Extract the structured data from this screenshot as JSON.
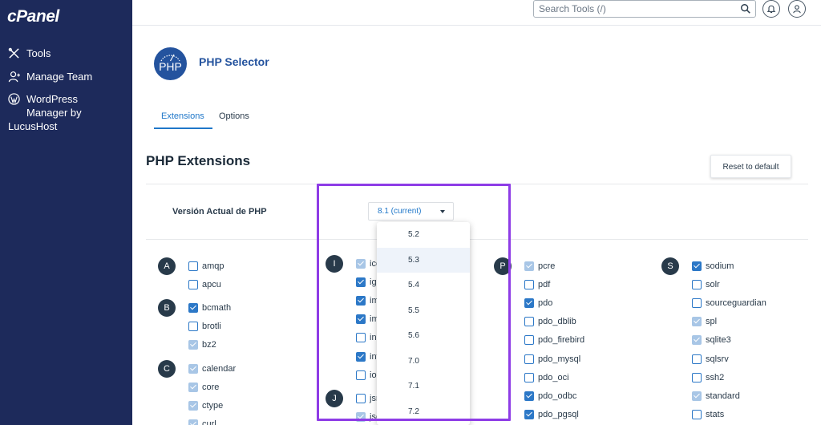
{
  "sidebar": {
    "logo": "cPanel",
    "items": [
      {
        "label": "Tools",
        "icon": "tools-icon"
      },
      {
        "label": "Manage Team",
        "icon": "manage-team-icon"
      },
      {
        "lines": [
          "WordPress",
          "Manager by",
          "LucusHost"
        ],
        "icon": "wordpress-icon"
      }
    ]
  },
  "topbar": {
    "search_placeholder": "Search Tools (/)",
    "icons": [
      "search-icon",
      "bell-icon",
      "user-icon"
    ]
  },
  "page": {
    "logo_text": "PHP",
    "title": "PHP Selector",
    "tabs": [
      {
        "label": "Extensions",
        "active": true
      },
      {
        "label": "Options",
        "active": false
      }
    ],
    "section_title": "PHP Extensions",
    "reset_button": "Reset to default",
    "version_label": "Versión Actual de PHP",
    "version_selected": "8.1 (current)"
  },
  "dropdown_options": [
    "5.2",
    "5.3",
    "5.4",
    "5.5",
    "5.6",
    "7.0",
    "7.1",
    "7.2"
  ],
  "dropdown_highlighted": "5.3",
  "columns": [
    {
      "groups": [
        {
          "letter": "A",
          "items": [
            {
              "name": "amqp",
              "state": "off"
            },
            {
              "name": "apcu",
              "state": "off"
            }
          ]
        },
        {
          "letter": "B",
          "items": [
            {
              "name": "bcmath",
              "state": "on"
            },
            {
              "name": "brotli",
              "state": "off"
            },
            {
              "name": "bz2",
              "state": "disabled"
            }
          ]
        },
        {
          "letter": "C",
          "items": [
            {
              "name": "calendar",
              "state": "disabled"
            },
            {
              "name": "core",
              "state": "disabled"
            },
            {
              "name": "ctype",
              "state": "disabled"
            },
            {
              "name": "curl",
              "state": "disabled"
            }
          ]
        }
      ]
    },
    {
      "groups": [
        {
          "letter": "I",
          "items": [
            {
              "name": "icc",
              "state": "disabled"
            },
            {
              "name": "igb",
              "state": "on"
            },
            {
              "name": "im",
              "state": "on"
            },
            {
              "name": "im",
              "state": "on"
            },
            {
              "name": "inc",
              "state": "off"
            },
            {
              "name": "int",
              "state": "on"
            },
            {
              "name": "ion",
              "state": "off"
            }
          ]
        },
        {
          "letter": "J",
          "items": [
            {
              "name": "jsn",
              "state": "off"
            },
            {
              "name": "jso",
              "state": "disabled"
            }
          ]
        }
      ]
    },
    {
      "groups": [
        {
          "letter": "P",
          "items": [
            {
              "name": "pcre",
              "state": "disabled"
            },
            {
              "name": "pdf",
              "state": "off"
            },
            {
              "name": "pdo",
              "state": "on"
            },
            {
              "name": "pdo_dblib",
              "state": "off"
            },
            {
              "name": "pdo_firebird",
              "state": "off"
            },
            {
              "name": "pdo_mysql",
              "state": "off"
            },
            {
              "name": "pdo_oci",
              "state": "off"
            },
            {
              "name": "pdo_odbc",
              "state": "on"
            },
            {
              "name": "pdo_pgsql",
              "state": "on"
            }
          ]
        }
      ]
    },
    {
      "groups": [
        {
          "letter": "S",
          "items": [
            {
              "name": "sodium",
              "state": "on"
            },
            {
              "name": "solr",
              "state": "off"
            },
            {
              "name": "sourceguardian",
              "state": "off"
            },
            {
              "name": "spl",
              "state": "disabled"
            },
            {
              "name": "sqlite3",
              "state": "disabled"
            },
            {
              "name": "sqlsrv",
              "state": "off"
            },
            {
              "name": "ssh2",
              "state": "off"
            },
            {
              "name": "standard",
              "state": "disabled"
            },
            {
              "name": "stats",
              "state": "off"
            }
          ]
        }
      ]
    }
  ]
}
